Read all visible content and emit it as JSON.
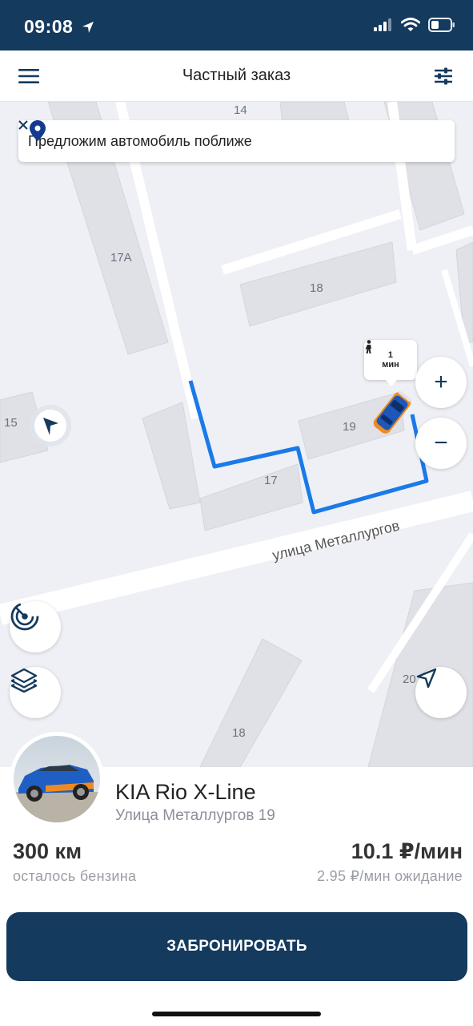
{
  "status_bar": {
    "time": "09:08",
    "icons": [
      "location-arrow-icon",
      "signal-icon",
      "wifi-icon",
      "battery-icon"
    ]
  },
  "header": {
    "title": "Частный заказ",
    "menu_icon": "menu-icon",
    "filter_icon": "filter-icon"
  },
  "banner": {
    "text": "Предложим автомобиль поближе",
    "icon": "location-pin-icon",
    "close_icon": "close-icon"
  },
  "map": {
    "building_labels": {
      "b14": "14",
      "b17a": "17А",
      "b18_top": "18",
      "b19": "19",
      "b17": "17",
      "b15": "15",
      "b20": "20",
      "b18_bottom": "18"
    },
    "street_label": "улица Металлургов",
    "walk_time": {
      "value": "1",
      "unit": "мин"
    },
    "colors": {
      "route": "#1a7ae8",
      "road": "#ffffff",
      "building": "#dfe1e6",
      "ground": "#eef0f5"
    }
  },
  "controls": {
    "zoom_in": "+",
    "zoom_out": "−"
  },
  "car": {
    "name": "KIA Rio X-Line",
    "address": "Улица Металлургов 19",
    "fuel_value": "300 км",
    "fuel_label": "осталось бензина",
    "price_value": "10.1 ₽/мин",
    "price_label": "2.95 ₽/мин ожидание"
  },
  "actions": {
    "book": "ЗАБРОНИРОВАТЬ"
  },
  "accent_color": "#143a5d"
}
